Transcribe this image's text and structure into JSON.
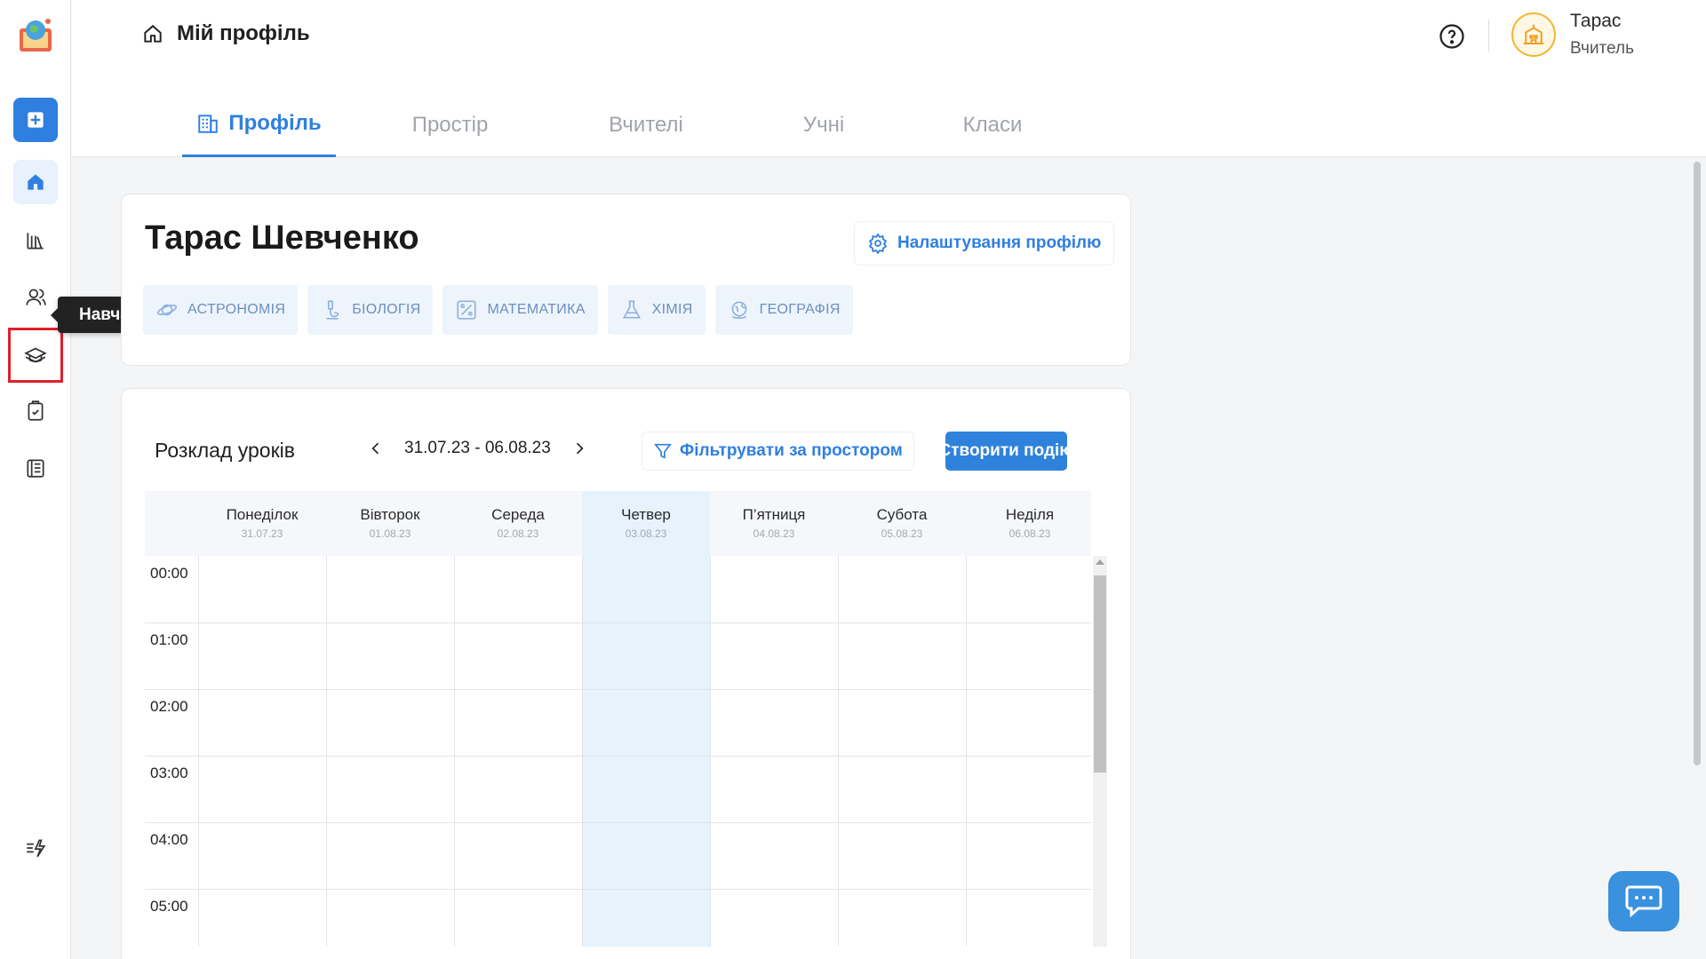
{
  "header": {
    "breadcrumb": "Мій профіль",
    "user_name": "Тарас",
    "user_role": "Вчитель"
  },
  "tabs": [
    {
      "label": "Профіль",
      "active": true
    },
    {
      "label": "Простір"
    },
    {
      "label": "Вчителі"
    },
    {
      "label": "Учні"
    },
    {
      "label": "Класи"
    }
  ],
  "sidebar": {
    "tooltip": "Навчальні плани",
    "items": [
      "add-icon",
      "home-icon",
      "library-icon",
      "users-icon",
      "graduation-cap-icon",
      "task-check-icon",
      "journal-icon",
      "flash-list-icon"
    ]
  },
  "profile": {
    "name": "Тарас Шевченко",
    "settings_label": "Налаштування профілю",
    "subjects": [
      "АСТРОНОМІЯ",
      "БІОЛОГІЯ",
      "МАТЕМАТИКА",
      "ХІМІЯ",
      "ГЕОГРАФІЯ"
    ]
  },
  "schedule": {
    "title": "Розклад уроків",
    "date_range": "31.07.23 - 06.08.23",
    "filter_label": "Фільтрувати за простором",
    "create_label": "Створити подію",
    "days": [
      {
        "name": "Понеділок",
        "date": "31.07.23"
      },
      {
        "name": "Вівторок",
        "date": "01.08.23"
      },
      {
        "name": "Середа",
        "date": "02.08.23"
      },
      {
        "name": "Четвер",
        "date": "03.08.23",
        "today": true
      },
      {
        "name": "П’ятниця",
        "date": "04.08.23"
      },
      {
        "name": "Субота",
        "date": "05.08.23"
      },
      {
        "name": "Неділя",
        "date": "06.08.23"
      }
    ],
    "times": [
      "00:00",
      "01:00",
      "02:00",
      "03:00",
      "04:00",
      "05:00"
    ]
  },
  "colors": {
    "accent": "#2f7fe0",
    "today": "#e6f3fd",
    "highlight": "#e0202a"
  }
}
